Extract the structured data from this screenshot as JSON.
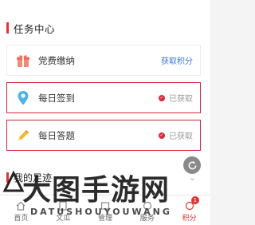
{
  "section": {
    "title": "任务中心"
  },
  "tasks": [
    {
      "name": "党费缴纳",
      "action": "获取积分",
      "icon": "gift-icon"
    },
    {
      "name": "每日签到",
      "status": "已获取",
      "icon": "location-pin-icon"
    },
    {
      "name": "每日答题",
      "status": "已获取",
      "icon": "pencil-icon"
    }
  ],
  "footprint": {
    "title": "我的足迹"
  },
  "tabbar": {
    "items": [
      {
        "label": "首页",
        "icon": "home-icon"
      },
      {
        "label": "文瓜",
        "icon": "document-icon"
      },
      {
        "label": "管理",
        "icon": "manage-icon"
      },
      {
        "label": "服务",
        "icon": "service-icon"
      },
      {
        "label": "积分",
        "icon": "points-icon",
        "badge": "1"
      }
    ]
  },
  "watermark": {
    "main": "大图手游网",
    "sub": "DATUSHOUYOUWANG"
  },
  "colors": {
    "accent": "#e2342f",
    "link": "#3a7bd5",
    "highlight_border": "#d42a3a"
  }
}
